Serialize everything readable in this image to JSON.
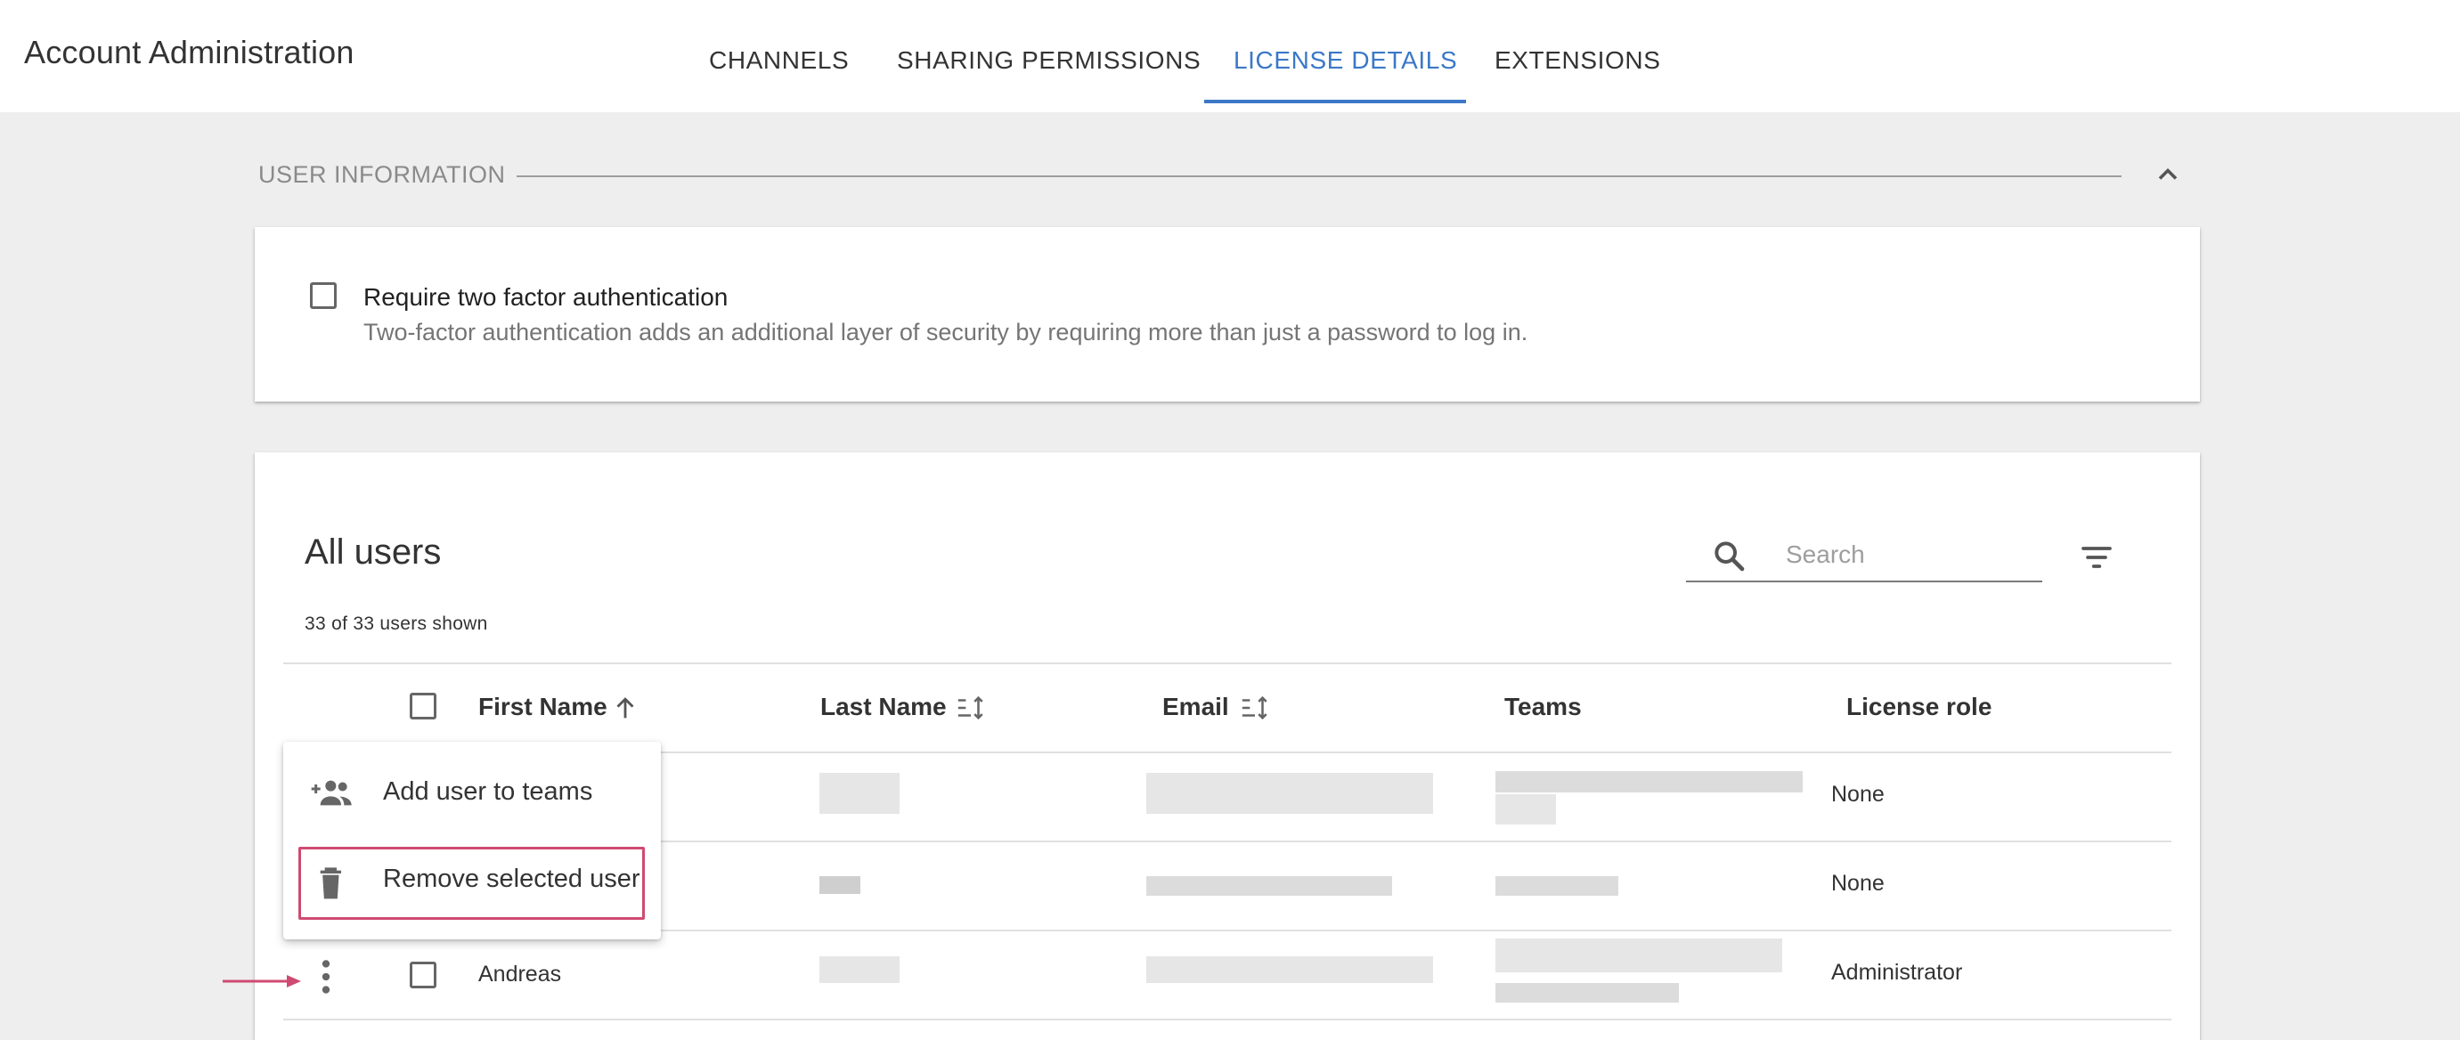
{
  "header": {
    "title": "Account Administration",
    "tabs": [
      {
        "label": "CHANNELS",
        "active": false
      },
      {
        "label": "SHARING PERMISSIONS",
        "active": false
      },
      {
        "label": "LICENSE DETAILS",
        "active": true
      },
      {
        "label": "EXTENSIONS",
        "active": false
      }
    ]
  },
  "user_information": {
    "section_title": "USER INFORMATION",
    "collapse_icon": "chevron-up-icon",
    "two_factor": {
      "label": "Require two factor authentication",
      "description": "Two-factor authentication adds an additional layer of security by requiring more than just a password to log in.",
      "checked": false
    }
  },
  "users": {
    "title": "All users",
    "count_text": "33 of 33 users shown",
    "search": {
      "placeholder": "Search",
      "value": "",
      "icon": "search-icon"
    },
    "filter_icon": "filter-icon",
    "columns": [
      "First Name",
      "Last Name",
      "Email",
      "Teams",
      "License role"
    ],
    "sort": {
      "column": "First Name",
      "direction": "ascending"
    },
    "rows": [
      {
        "first_name": "",
        "license_role": "None",
        "redacted": true
      },
      {
        "first_name": "",
        "license_role": "None",
        "redacted": true
      },
      {
        "first_name": "Andreas",
        "license_role": "Administrator",
        "redacted": true
      }
    ]
  },
  "context_menu": {
    "items": [
      {
        "label": "Add user to teams",
        "icon": "add-group-icon"
      },
      {
        "label": "Remove selected user",
        "icon": "trash-icon",
        "highlighted": true
      }
    ]
  },
  "colors": {
    "accent": "#3b78c7",
    "highlight": "#cf4a72",
    "background": "#eeeeee"
  }
}
